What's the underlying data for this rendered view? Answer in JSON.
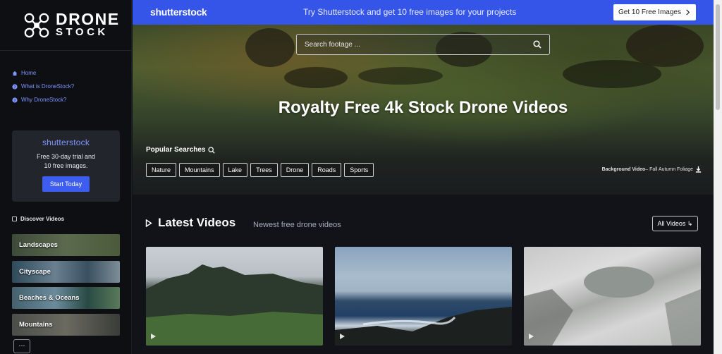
{
  "logo": {
    "line1": "DRONE",
    "line2": "STOCK"
  },
  "sidebar": {
    "nav": [
      {
        "label": "Home",
        "icon": "home-icon"
      },
      {
        "label": "What is DroneStock?",
        "icon": "question-icon"
      },
      {
        "label": "Why DroneStock?",
        "icon": "question-icon"
      }
    ],
    "promo": {
      "brand": "shutterstock",
      "line1": "Free 30-day trial and",
      "line2": "10 free images.",
      "button": "Start Today"
    },
    "discover_label": "Discover Videos",
    "categories": [
      "Landscapes",
      "Cityscape",
      "Beaches & Oceans",
      "Mountains"
    ],
    "more_label": "..."
  },
  "topbar": {
    "brand": "shutterstock",
    "promo_text": "Try Shutterstock and get 10 free images for your projects",
    "cta": "Get 10 Free Images",
    "cta_icon": "chevron-right-icon"
  },
  "hero": {
    "search_placeholder": "Search footage ...",
    "title": "Royalty Free 4k Stock Drone Videos",
    "popular_label": "Popular Searches",
    "tags": [
      "Nature",
      "Mountains",
      "Lake",
      "Trees",
      "Drone",
      "Roads",
      "Sports"
    ],
    "bg_video_bold": "Background Video",
    "bg_video_rest": " – Fall Autumn Foliage"
  },
  "latest": {
    "title": "Latest Videos",
    "subtitle": "Newest free drone videos",
    "all_button": "All Videos ↳"
  },
  "colors": {
    "accent": "#3554e8",
    "link": "#7f95ff",
    "bg": "#111319"
  }
}
